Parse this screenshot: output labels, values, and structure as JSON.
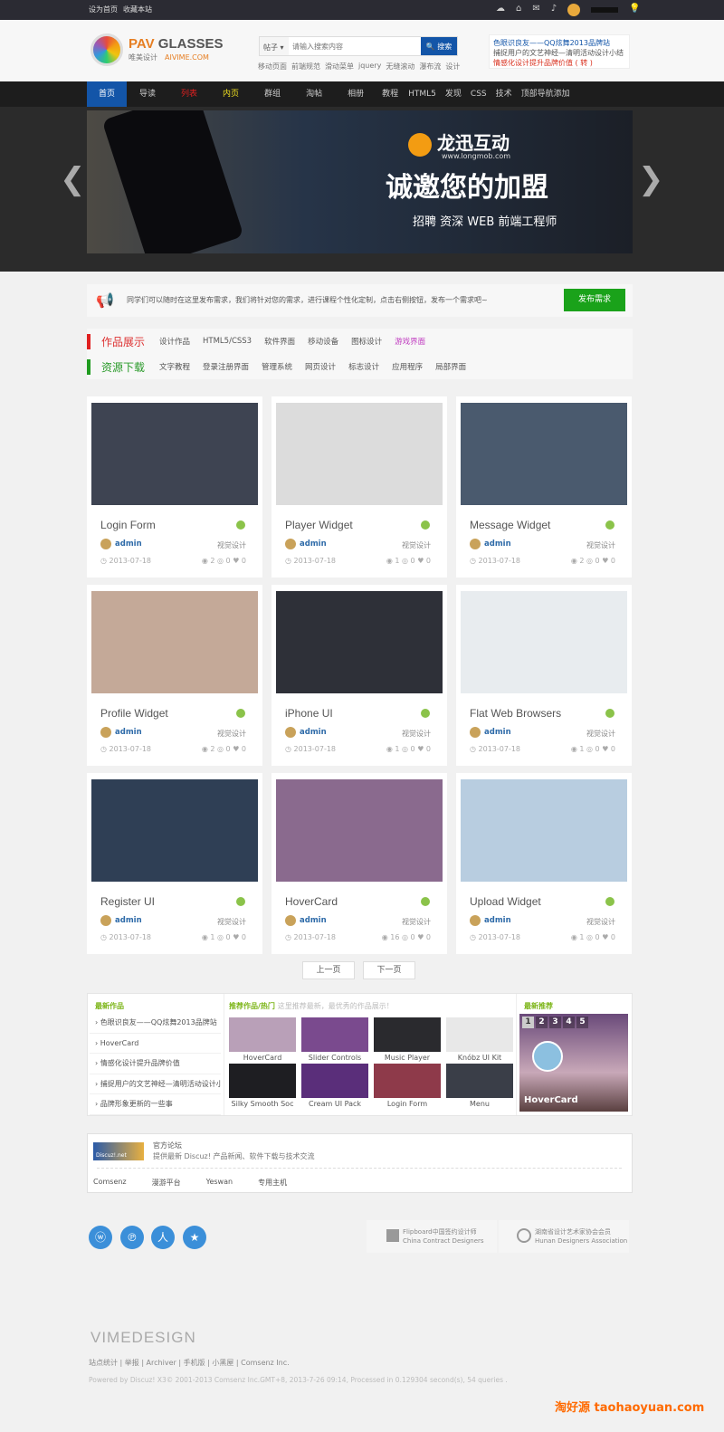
{
  "topbar": {
    "links": [
      "设为首页",
      "收藏本站"
    ]
  },
  "header": {
    "logo_title_a": "PAV",
    "logo_title_b": " GLASSES",
    "logo_sub": "唯美设计",
    "logo_domain": "AIVIME.COM",
    "search": {
      "type": "帖子 ▾",
      "placeholder": "请输入搜索内容",
      "button": "搜索",
      "hot": [
        "移动页面",
        "前端规范",
        "滑动菜单",
        "jquery",
        "无缝滚动",
        "瀑布流",
        "设计"
      ]
    },
    "ad": [
      "色眼识良友——QQ炫舞2013品牌站",
      "捕捉用户的文艺神经—清明活动设计小结",
      "情感化设计提升品牌价值 ( 转 )"
    ]
  },
  "nav": {
    "items": [
      "首页",
      "导读",
      "列表",
      "内页",
      "群组",
      "淘帖",
      "相册",
      "教程",
      "HTML5",
      "发现",
      "CSS",
      "技术",
      "顶部导航添加"
    ]
  },
  "banner": {
    "brand": "龙迅互动",
    "site": "www.longmob.com",
    "headline": "诚邀您的加盟",
    "sub": "招聘 资深 WEB 前端工程师"
  },
  "notice": {
    "text": "同学们可以随时在这里发布需求，我们将针对您的需求，进行课程个性化定制，点击右侧按钮，发布一个需求吧~",
    "button": "发布需求"
  },
  "categories": [
    {
      "title": "作品展示",
      "color": "#e02020",
      "items": [
        "设计作品",
        "HTML5/CSS3",
        "软件界面",
        "移动设备",
        "图标设计",
        "游戏界面"
      ]
    },
    {
      "title": "资源下载",
      "color": "#1f9b1f",
      "items": [
        "文字教程",
        "登录注册界面",
        "管理系统",
        "网页设计",
        "标志设计",
        "应用程序",
        "局部界面"
      ]
    }
  ],
  "cards": [
    {
      "title": "Login Form",
      "author": "admin",
      "cat": "视觉设计",
      "date": "2013-07-18",
      "views": "2",
      "comments": "0",
      "likes": "0",
      "bg": "#3e4452"
    },
    {
      "title": "Player Widget",
      "author": "admin",
      "cat": "视觉设计",
      "date": "2013-07-18",
      "views": "1",
      "comments": "0",
      "likes": "0",
      "bg": "#dcdcdc"
    },
    {
      "title": "Message Widget",
      "author": "admin",
      "cat": "视觉设计",
      "date": "2013-07-18",
      "views": "2",
      "comments": "0",
      "likes": "0",
      "bg": "#4a5a6e"
    },
    {
      "title": "Profile Widget",
      "author": "admin",
      "cat": "视觉设计",
      "date": "2013-07-18",
      "views": "2",
      "comments": "0",
      "likes": "0",
      "bg": "#c4a998"
    },
    {
      "title": "iPhone UI",
      "author": "admin",
      "cat": "视觉设计",
      "date": "2013-07-18",
      "views": "1",
      "comments": "0",
      "likes": "0",
      "bg": "#2e3038"
    },
    {
      "title": "Flat Web Browsers",
      "author": "admin",
      "cat": "视觉设计",
      "date": "2013-07-18",
      "views": "1",
      "comments": "0",
      "likes": "0",
      "bg": "#e8ecef"
    },
    {
      "title": "Register UI",
      "author": "admin",
      "cat": "视觉设计",
      "date": "2013-07-18",
      "views": "1",
      "comments": "0",
      "likes": "0",
      "bg": "#2f3f55"
    },
    {
      "title": "HoverCard",
      "author": "admin",
      "cat": "视觉设计",
      "date": "2013-07-18",
      "views": "16",
      "comments": "0",
      "likes": "0",
      "bg": "#8a6a8e"
    },
    {
      "title": "Upload Widget",
      "author": "admin",
      "cat": "视觉设计",
      "date": "2013-07-18",
      "views": "1",
      "comments": "0",
      "likes": "0",
      "bg": "#b8cde0"
    }
  ],
  "pagination": {
    "prev": "上一页",
    "next": "下一页"
  },
  "bottom": {
    "latest_title": "最新作品",
    "latest": [
      "色眼识良友——QQ炫舞2013品牌站",
      "HoverCard",
      "情感化设计提升品牌价值",
      "捕捉用户的文艺神经—清明活动设计小结",
      "品牌形象更新的一些事"
    ],
    "rec_title": "推荐作品/热门",
    "rec_sub": "这里推荐最新，最优秀的作品展示！",
    "rec": [
      {
        "t": "HoverCard",
        "c": "#b9a0b8"
      },
      {
        "t": "Slider Controls",
        "c": "#7a4a8e"
      },
      {
        "t": "Music Player",
        "c": "#2a2a2e"
      },
      {
        "t": "Knóbz UI Kit",
        "c": "#e8e8e8"
      },
      {
        "t": "Silky Smooth Soc",
        "c": "#1e1e22"
      },
      {
        "t": "Cream UI Pack",
        "c": "#5a2e7a"
      },
      {
        "t": "Login Form",
        "c": "#8e3a4a"
      },
      {
        "t": "Menu",
        "c": "#3a3e48"
      }
    ],
    "new_title": "最新推荐",
    "slider_pages": [
      "1",
      "2",
      "3",
      "4",
      "5"
    ],
    "slider_caption": "HoverCard"
  },
  "links": {
    "title": "官方论坛",
    "desc": "提供最新 Discuz! 产品新闻、软件下载与技术交流",
    "logo": "Discuz!.net",
    "items": [
      "Comsenz",
      "漫游平台",
      "Yeswan",
      "专用主机"
    ]
  },
  "badges": [
    {
      "t": "Flipboard中国签约设计师",
      "s": "China Contract Designers"
    },
    {
      "t": "湖南省设计艺术家协会会员",
      "s": "Hunan Designers Association"
    }
  ],
  "footer": {
    "brand": "VIMEDESIGN",
    "links": "站点统计 | 举报 | Archiver | 手机版 | 小黑屋 | Comsenz Inc.",
    "powered": "Powered by Discuz! X3© 2001-2013 Comsenz Inc.GMT+8, 2013-7-26 09:14, Processed in 0.129304 second(s), 54 queries .",
    "watermark": "淘好源 taohaoyuan.com"
  }
}
